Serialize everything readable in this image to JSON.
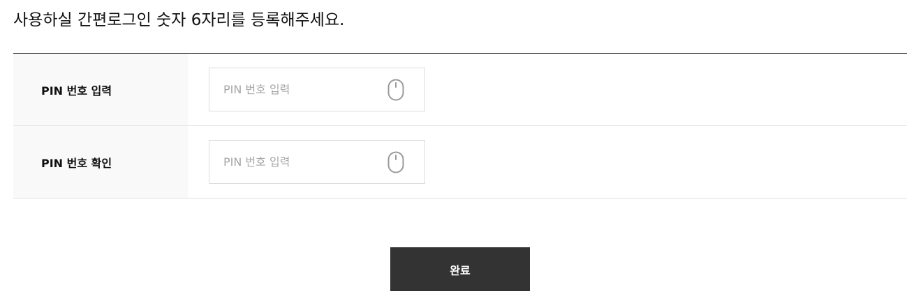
{
  "instruction": "사용하실 간편로그인 숫자 6자리를 등록해주세요.",
  "rows": [
    {
      "label": "PIN 번호 입력",
      "input_placeholder": "PIN 번호 입력",
      "input_value": "",
      "icon": "mouse-icon"
    },
    {
      "label": "PIN 번호 확인",
      "input_placeholder": "PIN 번호 입력",
      "input_value": "",
      "icon": "mouse-icon"
    }
  ],
  "submit_label": "완료",
  "colors": {
    "border_top": "#222222",
    "row_border": "#e2e2e2",
    "label_background": "#f9f9f9",
    "input_border": "#dcdcdc",
    "placeholder": "#a6a6a6",
    "button_background": "#333333",
    "button_text": "#ffffff"
  }
}
